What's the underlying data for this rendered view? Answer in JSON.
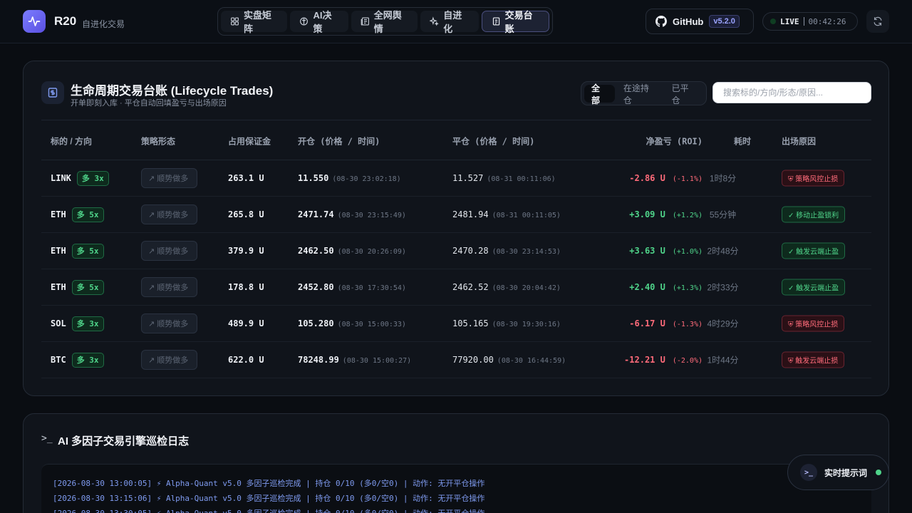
{
  "brand": {
    "name": "R20",
    "subtitle": "自进化交易"
  },
  "nav": [
    {
      "label": "实盘矩阵",
      "icon": "grid-icon",
      "active": false
    },
    {
      "label": "AI决策",
      "icon": "brain-icon",
      "active": false
    },
    {
      "label": "全网舆情",
      "icon": "newspaper-icon",
      "active": false
    },
    {
      "label": "自进化",
      "icon": "sparkles-icon",
      "active": false
    },
    {
      "label": "交易台账",
      "icon": "receipt-icon",
      "active": true
    }
  ],
  "github": {
    "label": "GitHub",
    "version": "v5.2.0"
  },
  "live": {
    "label": "LIVE",
    "time": "00:42:26"
  },
  "card": {
    "title": "生命周期交易台账 (Lifecycle Trades)",
    "subtitle": "开单即刻入库 · 平仓自动回填盈亏与出场原因",
    "filters": [
      "全部",
      "在途持仓",
      "已平仓"
    ],
    "active_filter": "全部",
    "search_placeholder": "搜索标的/方向/形态/原因..."
  },
  "table": {
    "headers": [
      "标的 / 方向",
      "策略形态",
      "占用保证金",
      "开仓 (价格 / 时间)",
      "平仓 (价格 / 时间)",
      "净盈亏 (ROI)",
      "耗时",
      "出场原因"
    ],
    "rows": [
      {
        "symbol": "LINK",
        "side": "多 3x",
        "strategy": "顺势做多",
        "margin": "263.1 U",
        "open_price": "11.550",
        "open_time": "(08-30 23:02:18)",
        "close_price": "11.527",
        "close_time": "(08-31 00:11:06)",
        "pnl": "-2.86 U",
        "roi": "(-1.1%)",
        "positive": false,
        "duration": "1时8分",
        "reason": "策略风控止损"
      },
      {
        "symbol": "ETH",
        "side": "多 5x",
        "strategy": "顺势做多",
        "margin": "265.8 U",
        "open_price": "2471.74",
        "open_time": "(08-30 23:15:49)",
        "close_price": "2481.94",
        "close_time": "(08-31 00:11:05)",
        "pnl": "+3.09 U",
        "roi": "(+1.2%)",
        "positive": true,
        "duration": "55分钟",
        "reason": "移动止盈锁利"
      },
      {
        "symbol": "ETH",
        "side": "多 5x",
        "strategy": "顺势做多",
        "margin": "379.9 U",
        "open_price": "2462.50",
        "open_time": "(08-30 20:26:09)",
        "close_price": "2470.28",
        "close_time": "(08-30 23:14:53)",
        "pnl": "+3.63 U",
        "roi": "(+1.0%)",
        "positive": true,
        "duration": "2时48分",
        "reason": "触发云端止盈"
      },
      {
        "symbol": "ETH",
        "side": "多 5x",
        "strategy": "顺势做多",
        "margin": "178.8 U",
        "open_price": "2452.80",
        "open_time": "(08-30 17:30:54)",
        "close_price": "2462.52",
        "close_time": "(08-30 20:04:42)",
        "pnl": "+2.40 U",
        "roi": "(+1.3%)",
        "positive": true,
        "duration": "2时33分",
        "reason": "触发云端止盈"
      },
      {
        "symbol": "SOL",
        "side": "多 3x",
        "strategy": "顺势做多",
        "margin": "489.9 U",
        "open_price": "105.280",
        "open_time": "(08-30 15:00:33)",
        "close_price": "105.165",
        "close_time": "(08-30 19:30:16)",
        "pnl": "-6.17 U",
        "roi": "(-1.3%)",
        "positive": false,
        "duration": "4时29分",
        "reason": "策略风控止损"
      },
      {
        "symbol": "BTC",
        "side": "多 3x",
        "strategy": "顺势做多",
        "margin": "622.0 U",
        "open_price": "78248.99",
        "open_time": "(08-30 15:00:27)",
        "close_price": "77920.00",
        "close_time": "(08-30 16:44:59)",
        "pnl": "-12.21 U",
        "roi": "(-2.0%)",
        "positive": false,
        "duration": "1时44分",
        "reason": "触发云端止损"
      }
    ]
  },
  "log": {
    "title": "AI 多因子交易引擎巡检日志",
    "prompt": ">_",
    "lines": [
      "[2026-08-30 13:00:05] ⚡ Alpha-Quant v5.0 多因子巡检完成 | 持仓 0/10 (多0/空0) | 动作: 无开平仓操作",
      "[2026-08-30 13:15:06] ⚡ Alpha-Quant v5.0 多因子巡检完成 | 持仓 0/10 (多0/空0) | 动作: 无开平仓操作",
      "[2026-08-30 13:30:05] ⚡ Alpha-Quant v5.0 多因子巡检完成 | 持仓 0/10 (多0/空0) | 动作: 无开平仓操作"
    ]
  },
  "hint": {
    "label": "实时提示词",
    "icon": ">_"
  },
  "colors": {
    "positive": "#4fd48a",
    "negative": "#ff6b7a",
    "accent": "#7b7dff",
    "background": "#0a0d12"
  }
}
